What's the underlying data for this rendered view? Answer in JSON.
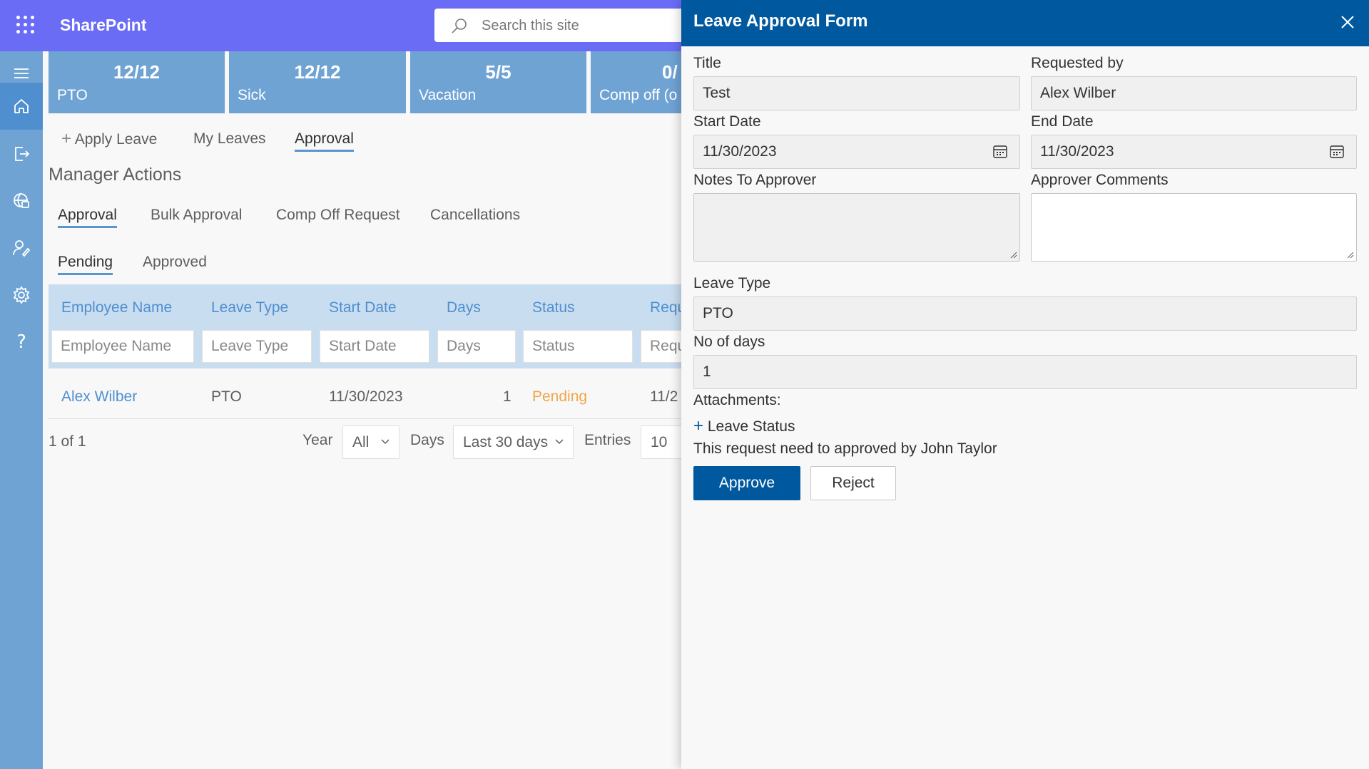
{
  "app": {
    "name": "SharePoint",
    "search_placeholder": "Search this site"
  },
  "rail": {
    "items": [
      {
        "icon": "menu-icon"
      },
      {
        "icon": "home-icon",
        "active": true
      },
      {
        "icon": "sign-out-icon"
      },
      {
        "icon": "globe-icon"
      },
      {
        "icon": "user-edit-icon"
      },
      {
        "icon": "gear-icon"
      },
      {
        "icon": "help-icon"
      }
    ]
  },
  "tiles": [
    {
      "value": "12/12",
      "label": "PTO"
    },
    {
      "value": "12/12",
      "label": "Sick"
    },
    {
      "value": "5/5",
      "label": "Vacation"
    },
    {
      "value": "0/",
      "label": "Comp off (o"
    }
  ],
  "main_tabs": {
    "apply_leave": "Apply Leave",
    "my_leaves": "My Leaves",
    "approval": "Approval"
  },
  "section_title": "Manager Actions",
  "sub_tabs": [
    "Approval",
    "Bulk Approval",
    "Comp Off Request",
    "Cancellations"
  ],
  "status_tabs": [
    "Pending",
    "Approved"
  ],
  "table": {
    "headers": [
      "Employee Name",
      "Leave Type",
      "Start Date",
      "Days",
      "Status",
      "Requ"
    ],
    "filter_placeholders": [
      "Employee Name",
      "Leave Type",
      "Start Date",
      "Days",
      "Status",
      "Requ"
    ],
    "rows": [
      {
        "employee": "Alex Wilber",
        "leave_type": "PTO",
        "start_date": "11/30/2023",
        "days": "1",
        "status": "Pending",
        "requested": "11/2"
      }
    ]
  },
  "pagination": {
    "page_info": "1 of 1",
    "year_label": "Year",
    "year_value": "All",
    "days_label": "Days",
    "days_value": "Last 30 days",
    "entries_label": "Entries",
    "entries_value": "10"
  },
  "colors": {
    "topbar": "#6b6cf6",
    "rail": "#6fa3d4",
    "panel_header": "#00589f",
    "link": "#4f8fd0",
    "pending": "#f0a64a"
  },
  "panel": {
    "title": "Leave Approval Form",
    "fields": {
      "title_label": "Title",
      "title_value": "Test",
      "requested_by_label": "Requested by",
      "requested_by_value": "Alex Wilber",
      "start_date_label": "Start Date",
      "start_date_value": "11/30/2023",
      "end_date_label": "End Date",
      "end_date_value": "11/30/2023",
      "notes_label": "Notes To Approver",
      "comments_label": "Approver Comments",
      "leave_type_label": "Leave Type",
      "leave_type_value": "PTO",
      "days_label": "No of days",
      "days_value": "1",
      "attachments_label": "Attachments:",
      "leave_status_label": "Leave Status",
      "approver_note": "This request need to approved by John Taylor"
    },
    "approve_label": "Approve",
    "reject_label": "Reject"
  }
}
